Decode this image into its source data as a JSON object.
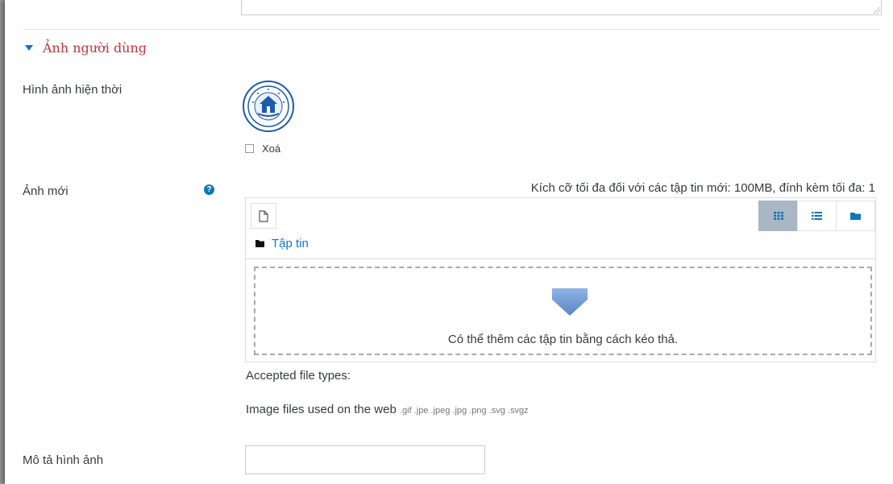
{
  "section": {
    "title": "Ảnh người dùng"
  },
  "current_picture": {
    "label": "Hình ảnh hiện thời",
    "delete_label": "Xoá"
  },
  "new_picture": {
    "label": "Ảnh mới",
    "max_size_text": "Kích cỡ tối đa đối với các tập tin mới: 100MB, đính kèm tối đa: 1",
    "path_label": "Tập tin",
    "drop_text": "Có thể thêm các tập tin bằng cách kéo thả.",
    "accepted_label": "Accepted file types:",
    "types_name": "Image files used on the web",
    "types_ext": ".gif .jpe .jpeg .jpg .png .svg .svgz"
  },
  "image_description": {
    "label": "Mô tả hình ảnh",
    "value": ""
  },
  "colors": {
    "section_title": "#c2333f",
    "link": "#0f75bc",
    "active_view_button": "#a9b6c3",
    "drop_arrow": "#6f9bd3"
  },
  "icons": {
    "new_file": "file-icon",
    "grid_view": "grid-icon",
    "list_view": "list-icon",
    "tree_view": "folder-icon",
    "path_folder": "folder-icon",
    "help": "question-circle-icon",
    "drop": "down-arrow-icon"
  }
}
